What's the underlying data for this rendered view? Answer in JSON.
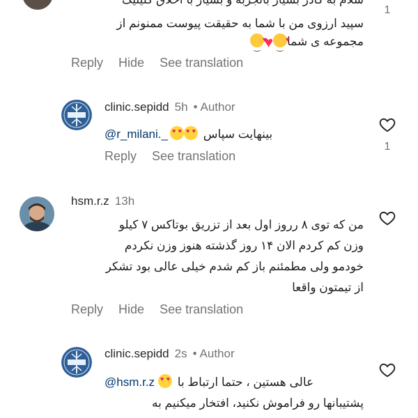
{
  "comment1": {
    "lines": [
      "سلام به کادر بسیار باتجربه و بسیار با اخلاق کلینیک",
      "سپید ارزوی من با شما به حقیقت پیوست ممنونم از",
      "مجموعه ی شما"
    ],
    "likes": "1",
    "actions": {
      "reply": "Reply",
      "hide": "Hide",
      "translate": "See translation"
    }
  },
  "reply1": {
    "username": "clinic.sepidd",
    "time": "5h",
    "role": "Author",
    "text": "بینهایت سپاس",
    "mention": "@r_milani._",
    "likes": "1",
    "actions": {
      "reply": "Reply",
      "translate": "See translation"
    }
  },
  "comment2": {
    "username": "hsm.r.z",
    "time": "13h",
    "lines": [
      "من که توی ۸ رروز اول بعد از تزریق بوتاکس ۷ کیلو",
      "وزن کم کردم الان ۱۴ روز گذشته هنوز وزن نکردم",
      "خودمو ولی مطمئنم باز کم شدم خیلی عالی بود تشکر",
      "از تیمتون واقعا"
    ],
    "actions": {
      "reply": "Reply",
      "hide": "Hide",
      "translate": "See translation"
    }
  },
  "reply2": {
    "username": "clinic.sepidd",
    "time": "2s",
    "role": "Author",
    "line1_text": "عالی هستین ، حتما ارتباط با",
    "mention": "@hsm.r.z",
    "line2": "پشتیبانها رو فراموش نکنید، افتخار میکنیم به"
  },
  "separator": "•"
}
